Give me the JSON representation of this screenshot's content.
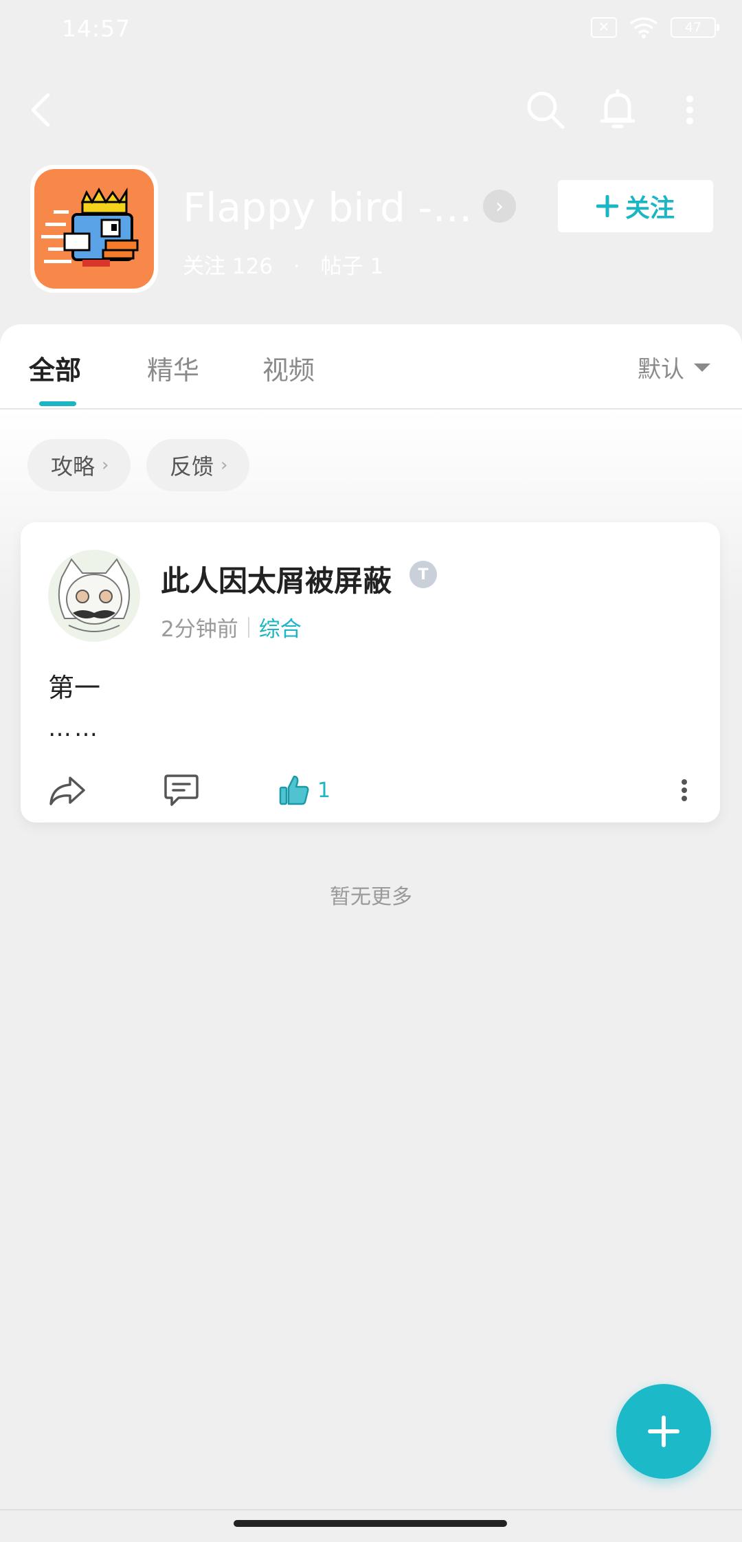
{
  "status_bar": {
    "time": "14:57",
    "battery": "47"
  },
  "header": {
    "title": "Flappy bird -…",
    "follow_button": "关注",
    "follow_label": "关注",
    "follow_count": "126",
    "post_label": "帖子",
    "post_count": "1",
    "separator": "·"
  },
  "tabs": [
    {
      "label": "全部",
      "active": true
    },
    {
      "label": "精华",
      "active": false
    },
    {
      "label": "视频",
      "active": false
    }
  ],
  "sort": {
    "label": "默认"
  },
  "chips": [
    {
      "label": "攻略"
    },
    {
      "label": "反馈"
    }
  ],
  "post": {
    "author": "此人因太屑被屏蔽",
    "badge": "T",
    "time": "2分钟前",
    "category": "综合",
    "text": "第一",
    "more": "……",
    "like_count": "1"
  },
  "footer": {
    "no_more": "暂无更多"
  },
  "icons": {
    "back": "back-arrow-icon",
    "search": "search-icon",
    "bell": "bell-icon",
    "more": "more-vertical-icon",
    "share": "share-icon",
    "comment": "comment-icon",
    "like": "thumbs-up-icon",
    "add": "plus-icon"
  },
  "colors": {
    "accent": "#1cb5c4",
    "app_icon": "#f7884a",
    "background": "#efeff0"
  }
}
